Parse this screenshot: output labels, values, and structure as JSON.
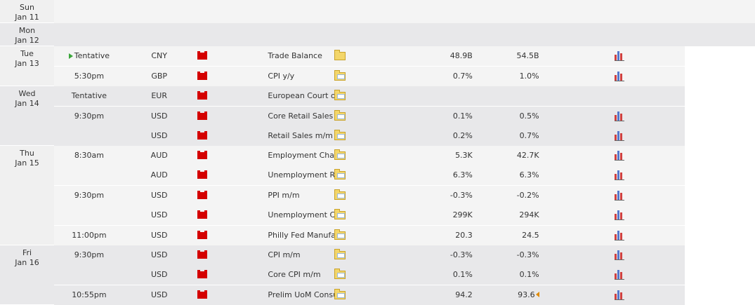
{
  "days": [
    {
      "day": "Sun",
      "date": "Jan 11"
    },
    {
      "day": "Mon",
      "date": "Jan 12"
    },
    {
      "day": "Tue",
      "date": "Jan 13"
    },
    {
      "day": "Wed",
      "date": "Jan 14"
    },
    {
      "day": "Thu",
      "date": "Jan 15"
    },
    {
      "day": "Fri",
      "date": "Jan 16"
    }
  ],
  "events": [
    {
      "time": "Tentative",
      "currency": "CNY",
      "title": "Trade Balance",
      "actual": "48.9B",
      "forecast": "54.5B"
    },
    {
      "time": "5:30pm",
      "currency": "GBP",
      "title": "CPI y/y",
      "actual": "0.7%",
      "forecast": "1.0%"
    },
    {
      "time": "Tentative",
      "currency": "EUR",
      "title": "European Court of Justice Ruling",
      "actual": "",
      "forecast": ""
    },
    {
      "time": "9:30pm",
      "currency": "USD",
      "title": "Core Retail Sales m/m",
      "actual": "0.1%",
      "forecast": "0.5%"
    },
    {
      "time": "",
      "currency": "USD",
      "title": "Retail Sales m/m",
      "actual": "0.2%",
      "forecast": "0.7%"
    },
    {
      "time": "8:30am",
      "currency": "AUD",
      "title": "Employment Change",
      "actual": "5.3K",
      "forecast": "42.7K"
    },
    {
      "time": "",
      "currency": "AUD",
      "title": "Unemployment Rate",
      "actual": "6.3%",
      "forecast": "6.3%"
    },
    {
      "time": "9:30pm",
      "currency": "USD",
      "title": "PPI m/m",
      "actual": "-0.3%",
      "forecast": "-0.2%"
    },
    {
      "time": "",
      "currency": "USD",
      "title": "Unemployment Claims",
      "actual": "299K",
      "forecast": "294K"
    },
    {
      "time": "11:00pm",
      "currency": "USD",
      "title": "Philly Fed Manufacturing Index",
      "actual": "20.3",
      "forecast": "24.5"
    },
    {
      "time": "9:30pm",
      "currency": "USD",
      "title": "CPI m/m",
      "actual": "-0.3%",
      "forecast": "-0.3%"
    },
    {
      "time": "",
      "currency": "USD",
      "title": "Core CPI m/m",
      "actual": "0.1%",
      "forecast": "0.1%"
    },
    {
      "time": "10:55pm",
      "currency": "USD",
      "title": "Prelim UoM Consumer Sentiment",
      "actual": "94.2",
      "forecast": "93.6"
    }
  ],
  "icons": {
    "tentative_marker": "green-triangle-icon",
    "impact": "red-impact-flag-icon",
    "detail": "folder-detail-icon",
    "graph": "bar-chart-icon",
    "revision": "orange-revision-arrow-icon"
  }
}
